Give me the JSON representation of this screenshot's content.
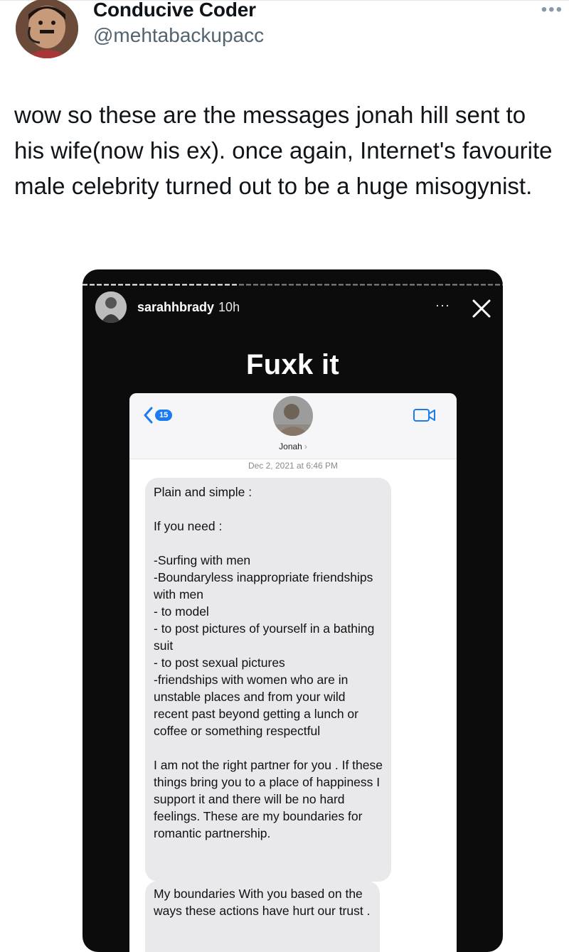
{
  "tweet": {
    "author_name": "Conducive Coder",
    "author_handle": "@mehtabackupacc",
    "more_label": "•••",
    "text": "wow so these are the messages  jonah hill sent to his wife(now his ex). once again, Internet's favourite male celebrity turned out to be a huge misogynist."
  },
  "story": {
    "username": "sarahhbrady",
    "time": "10h",
    "more_label": "···",
    "caption": "Fuxk it",
    "messages": {
      "back_badge": "15",
      "contact_name": "Jonah",
      "timestamp": "Dec 2, 2021 at 6:46 PM",
      "bubble1": "Plain and simple :\n\nIf you need :\n\n-Surfing with men\n-Boundaryless inappropriate friendships with men\n- to model\n- to post pictures of yourself in a bathing suit\n- to post sexual pictures\n-friendships with women who are in unstable places and from your wild recent past beyond getting a lunch or coffee or something respectful\n\nI am not the right partner for you . If these things bring you to a place of happiness I support it and there will be no hard feelings. These are my boundaries for romantic partnership.",
      "bubble2": "My boundaries With you based on the ways these actions have hurt our trust ."
    }
  },
  "icons": {
    "more": "more-dots-icon",
    "close": "close-icon",
    "back": "chevron-left-icon",
    "video": "video-camera-icon"
  },
  "colors": {
    "story_bg": "#0c0c0c",
    "imessage_blue": "#1a7cf0",
    "bubble_gray": "#e9e9eb",
    "handle_gray": "#536471"
  }
}
